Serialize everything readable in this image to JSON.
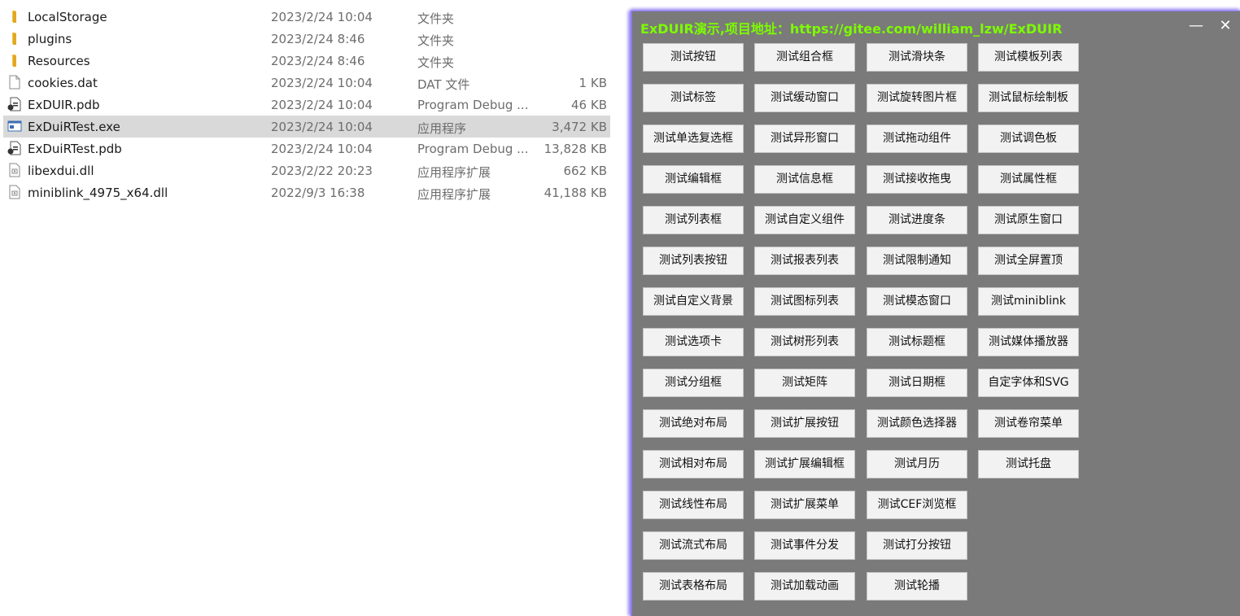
{
  "explorer": {
    "files": [
      {
        "icon": "folder-icon",
        "name": "LocalStorage",
        "date": "2023/2/24 10:04",
        "type": "文件夹",
        "size": ""
      },
      {
        "icon": "folder-icon",
        "name": "plugins",
        "date": "2023/2/24 8:46",
        "type": "文件夹",
        "size": ""
      },
      {
        "icon": "folder-icon",
        "name": "Resources",
        "date": "2023/2/24 8:46",
        "type": "文件夹",
        "size": ""
      },
      {
        "icon": "blank-file-icon",
        "name": "cookies.dat",
        "date": "2023/2/24 10:04",
        "type": "DAT 文件",
        "size": "1 KB"
      },
      {
        "icon": "pdb-file-icon",
        "name": "ExDUIR.pdb",
        "date": "2023/2/24 10:04",
        "type": "Program Debug ...",
        "size": "46 KB"
      },
      {
        "icon": "exe-file-icon",
        "name": "ExDuiRTest.exe",
        "date": "2023/2/24 10:04",
        "type": "应用程序",
        "size": "3,472 KB",
        "selected": true
      },
      {
        "icon": "pdb-file-icon",
        "name": "ExDuiRTest.pdb",
        "date": "2023/2/24 10:04",
        "type": "Program Debug ...",
        "size": "13,828 KB"
      },
      {
        "icon": "dll-file-icon",
        "name": "libexdui.dll",
        "date": "2023/2/22 20:23",
        "type": "应用程序扩展",
        "size": "662 KB"
      },
      {
        "icon": "dll-file-icon",
        "name": "miniblink_4975_x64.dll",
        "date": "2022/9/3 16:38",
        "type": "应用程序扩展",
        "size": "41,188 KB"
      }
    ]
  },
  "window": {
    "title": "ExDUIR演示,项目地址：https://gitee.com/william_lzw/ExDUIR",
    "minimize_label": "—",
    "close_label": "✕",
    "title_color": "#7cfc00",
    "buttons": [
      [
        "测试按钮",
        "测试组合框",
        "测试滑块条",
        "测试模板列表"
      ],
      [
        "测试标签",
        "测试缓动窗口",
        "测试旋转图片框",
        "测试鼠标绘制板"
      ],
      [
        "测试单选复选框",
        "测试异形窗口",
        "测试拖动组件",
        "测试调色板"
      ],
      [
        "测试编辑框",
        "测试信息框",
        "测试接收拖曳",
        "测试属性框"
      ],
      [
        "测试列表框",
        "测试自定义组件",
        "测试进度条",
        "测试原生窗口"
      ],
      [
        "测试列表按钮",
        "测试报表列表",
        "测试限制通知",
        "测试全屏置顶"
      ],
      [
        "测试自定义背景",
        "测试图标列表",
        "测试模态窗口",
        "测试miniblink"
      ],
      [
        "测试选项卡",
        "测试树形列表",
        "测试标题框",
        "测试媒体播放器"
      ],
      [
        "测试分组框",
        "测试矩阵",
        "测试日期框",
        "自定字体和SVG"
      ],
      [
        "测试绝对布局",
        "测试扩展按钮",
        "测试颜色选择器",
        "测试卷帘菜单"
      ],
      [
        "测试相对布局",
        "测试扩展编辑框",
        "测试月历",
        "测试托盘"
      ],
      [
        "测试线性布局",
        "测试扩展菜单",
        "测试CEF浏览框"
      ],
      [
        "测试流式布局",
        "测试事件分发",
        "测试打分按钮"
      ],
      [
        "测试表格布局",
        "测试加载动画",
        "测试轮播"
      ]
    ]
  }
}
